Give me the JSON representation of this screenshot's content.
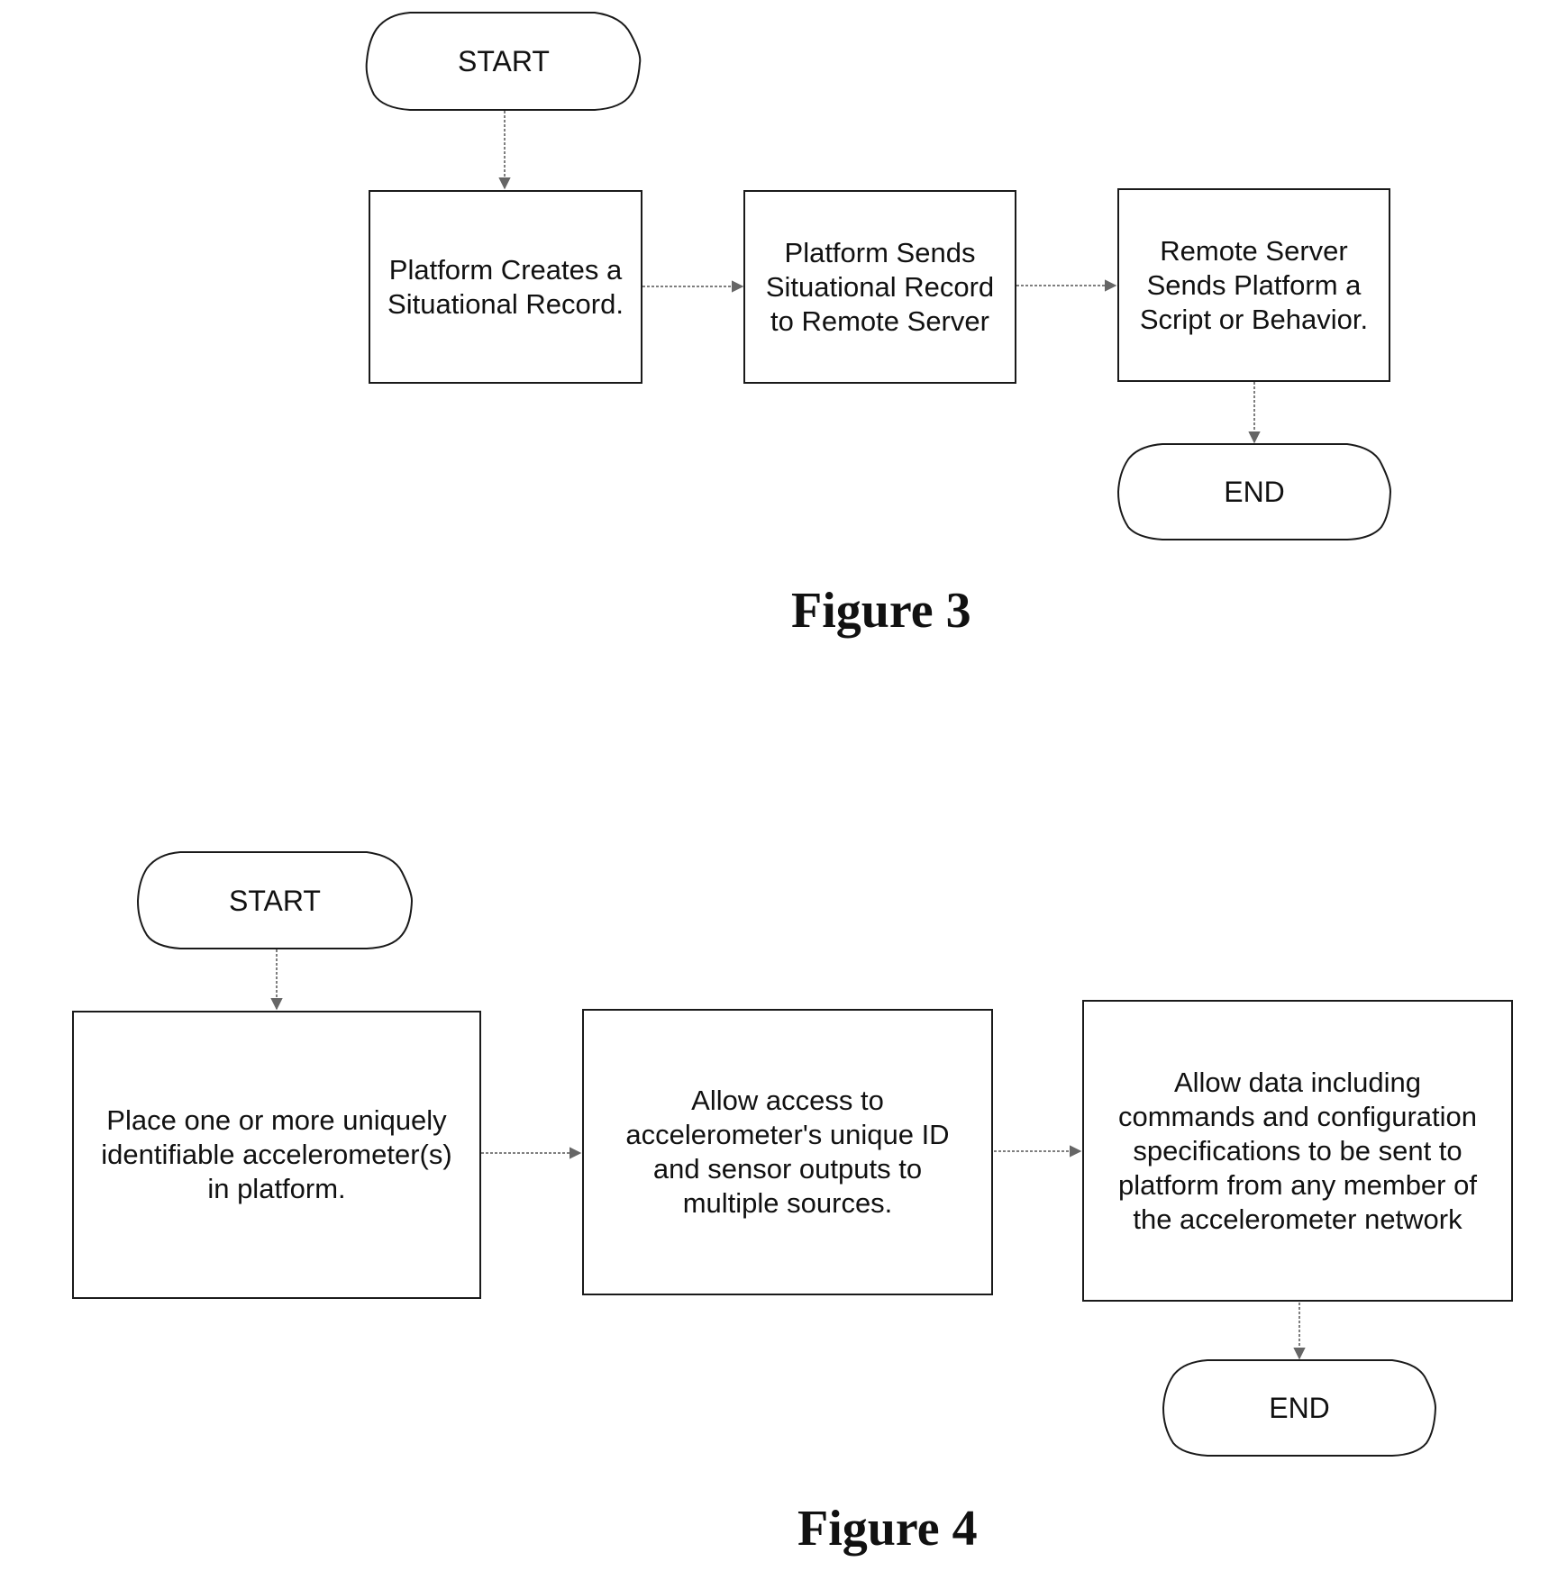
{
  "figures": [
    {
      "label": "Figure 3",
      "start": "START",
      "steps": [
        "Platform Creates a\nSituational Record.",
        "Platform Sends\nSituational Record\nto Remote Server",
        "Remote Server\nSends Platform a\nScript or Behavior."
      ],
      "end": "END"
    },
    {
      "label": "Figure 4",
      "start": "START",
      "steps": [
        "Place one or more  uniquely\nidentifiable accelerometer(s)\nin platform.",
        "Allow access to\naccelerometer's unique ID\nand sensor outputs to\nmultiple sources.",
        "Allow data including\ncommands and configuration\nspecifications to be sent to\nplatform from any member of\nthe accelerometer network"
      ],
      "end": "END"
    }
  ],
  "colors": {
    "line": "#1a1a1a",
    "connector": "#555555",
    "background": "#ffffff"
  }
}
